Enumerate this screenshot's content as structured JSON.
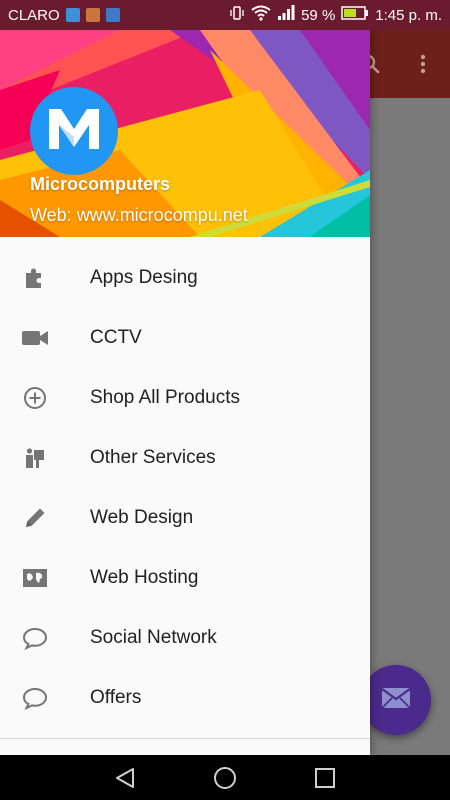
{
  "status_bar": {
    "carrier": "CLARO",
    "battery": "59 %",
    "time": "1:45 p. m."
  },
  "drawer": {
    "header": {
      "name": "Microcomputers",
      "web": "Web: www.microcompu.net",
      "avatar_icon": "m-logo-icon"
    },
    "items": [
      {
        "label": "Apps Desing",
        "icon": "puzzle-icon"
      },
      {
        "label": "CCTV",
        "icon": "video-camera-icon"
      },
      {
        "label": "Shop All Products",
        "icon": "add-circle-icon"
      },
      {
        "label": "Other Services",
        "icon": "services-icon"
      },
      {
        "label": "Web Design",
        "icon": "pencil-icon"
      },
      {
        "label": "Web Hosting",
        "icon": "hosting-icon"
      },
      {
        "label": "Social Network",
        "icon": "chat-bubble-icon"
      },
      {
        "label": "Offers",
        "icon": "chat-bubble-icon"
      }
    ]
  },
  "colors": {
    "toolbar": "#6d1f1a",
    "fab": "#4a2a8a",
    "icon_gray": "#757575"
  }
}
